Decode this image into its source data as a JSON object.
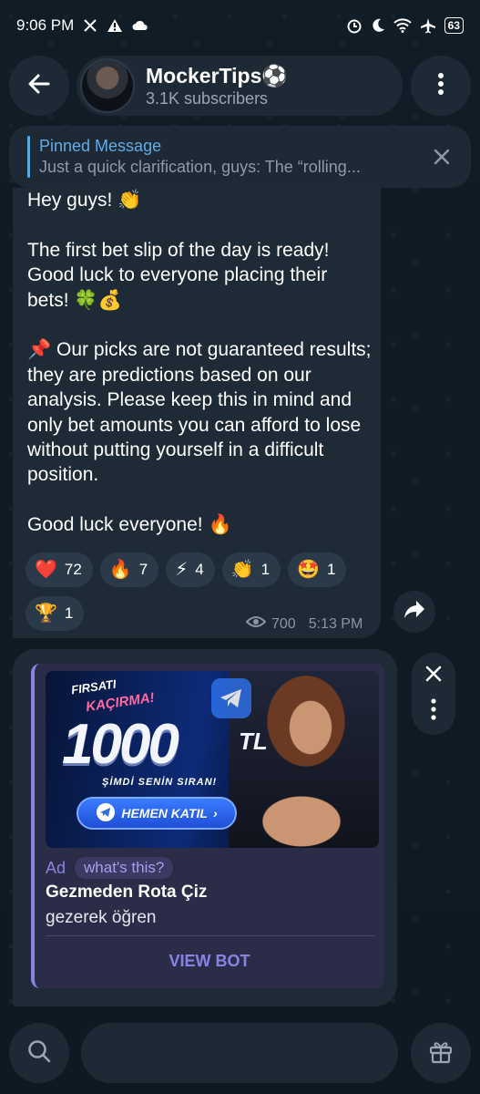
{
  "status_bar": {
    "time": "9:06 PM",
    "battery": "63",
    "icons": [
      "x-icon",
      "warning-icon",
      "cloud-icon",
      "alarm-icon",
      "moon-icon",
      "wifi-icon",
      "airplane-icon"
    ]
  },
  "header": {
    "channel_name": "MockerTips⚽",
    "subscribers": "3.1K subscribers"
  },
  "pinned": {
    "title": "Pinned Message",
    "preview": "Just a quick clarification, guys:  The “rolling..."
  },
  "message": {
    "text": "Hey guys! 👏\n\nThe first bet slip of the day is ready! Good luck to everyone placing their bets! 🍀💰\n\n📌 Our picks are not guaranteed results; they are predictions based on our analysis. Please keep this in mind and only bet amounts you can afford to lose without putting yourself in a difficult position.\n\nGood luck everyone! 🔥",
    "reactions": [
      {
        "emoji": "❤️",
        "count": "72"
      },
      {
        "emoji": "🔥",
        "count": "7"
      },
      {
        "emoji": "⚡",
        "count": "4"
      },
      {
        "emoji": "👏",
        "count": "1"
      },
      {
        "emoji": "🤩",
        "count": "1"
      },
      {
        "emoji": "🏆",
        "count": "1"
      }
    ],
    "views": "700",
    "time": "5:13 PM"
  },
  "ad": {
    "image": {
      "slogan_1": "FIRSATI",
      "slogan_2": "KAÇIRMA!",
      "amount": "1000",
      "currency": "TL",
      "sub": "ŞİMDİ SENİN SIRAN!",
      "cta": "HEMEN KATIL"
    },
    "label": "Ad",
    "whats_this": "what's this?",
    "title": "Gezmeden Rota Çiz",
    "description": "gezerek öğren",
    "button": "VIEW BOT"
  },
  "colors": {
    "accent": "#62abe6",
    "ad_accent": "#8b82e6",
    "bubble": "#1e2b36",
    "background": "#0f1a22"
  }
}
